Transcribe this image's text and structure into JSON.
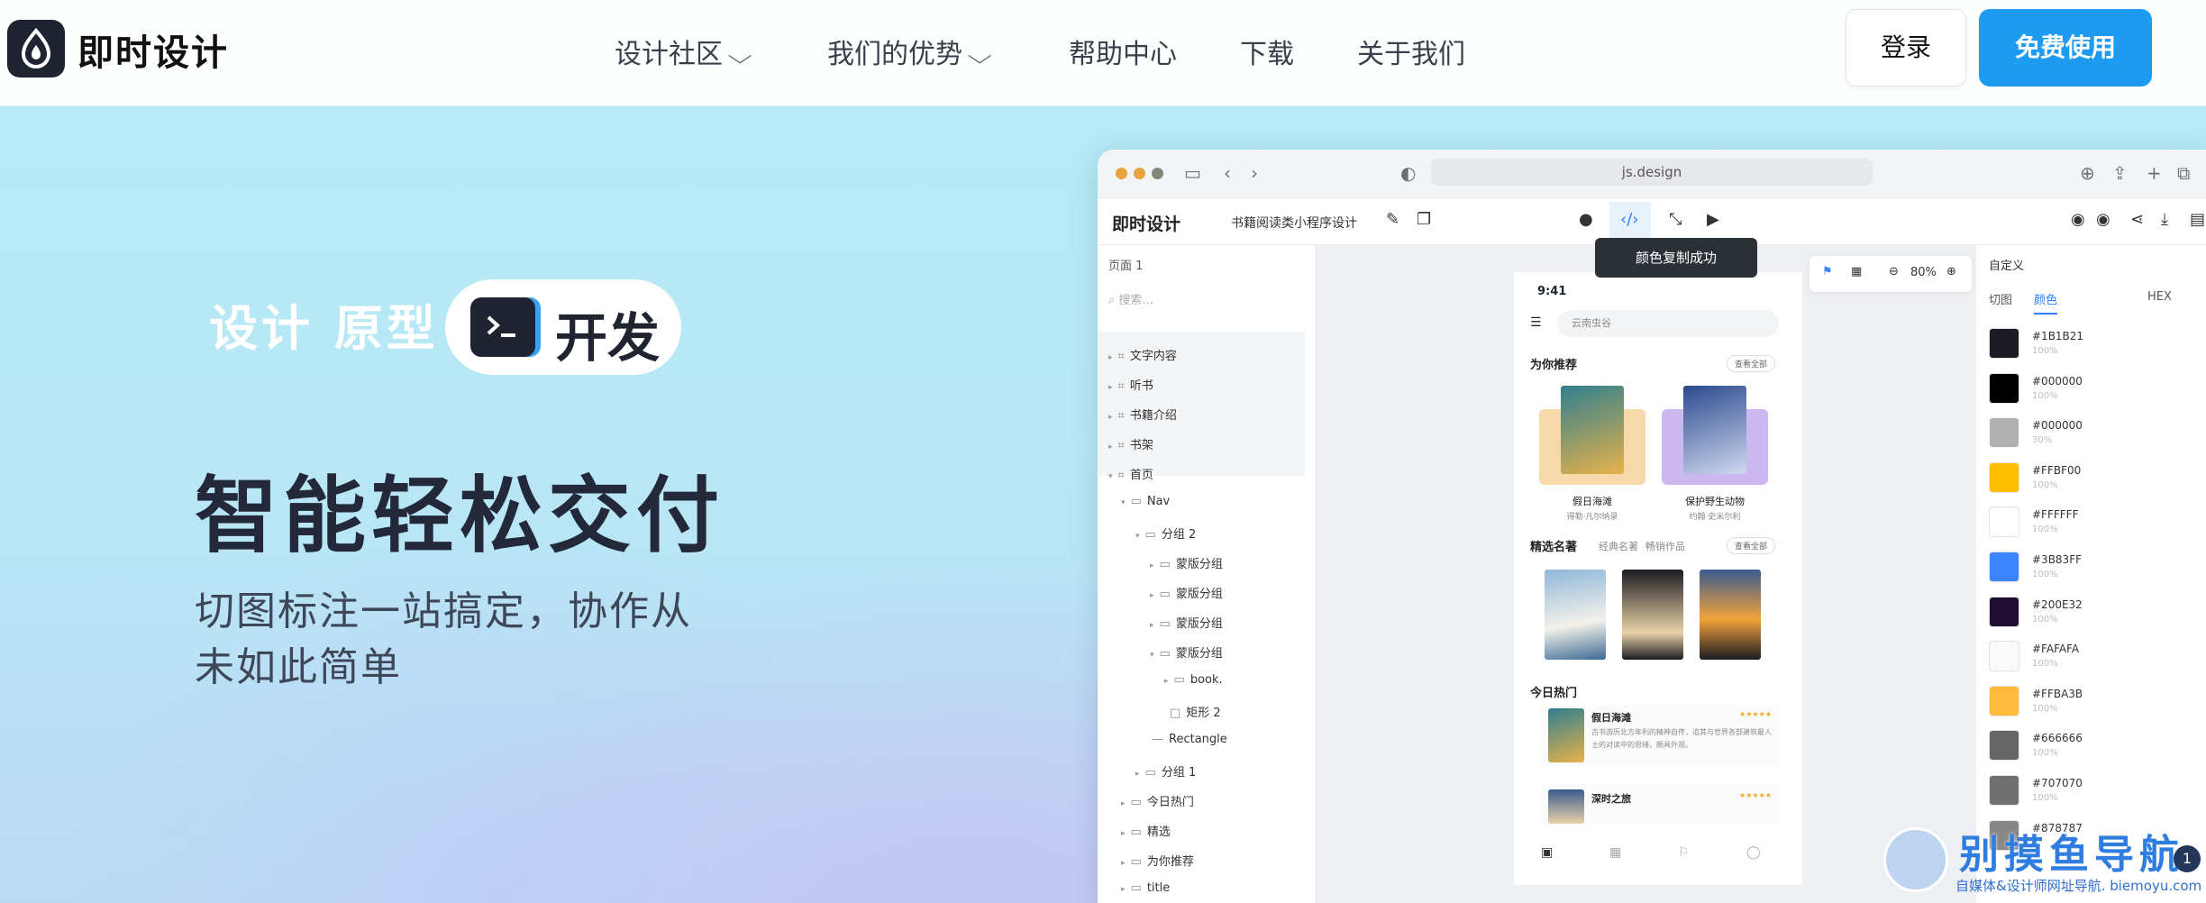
{
  "nav": {
    "brand": "即时设计",
    "items": [
      {
        "label": "设计社区",
        "chevron": true
      },
      {
        "label": "我们的优势",
        "chevron": true
      },
      {
        "label": "帮助中心"
      },
      {
        "label": "下载"
      },
      {
        "label": "关于我们"
      }
    ],
    "login": "登录",
    "cta": "免费使用"
  },
  "hero": {
    "tags": "设计 原型",
    "dev": "开发",
    "headline": "智能轻松交付",
    "sub": "切图标注一站搞定，协作从未如此简单"
  },
  "app": {
    "url": "js.design",
    "brand": "即时设计",
    "file": "书籍阅读类小程序设计",
    "tooltip": "颜色复制成功",
    "left": {
      "page": "页面 1",
      "search": "搜索...",
      "layers": [
        "文字内容",
        "听书",
        "书籍介绍",
        "书架",
        "首页",
        "Nav",
        "分组 2",
        "蒙版分组",
        "蒙版分组",
        "蒙版分组",
        "蒙版分组",
        "book.",
        "矩形 2",
        "Rectangle",
        "分组 1",
        "今日热门",
        "精选",
        "为你推荐",
        "title"
      ]
    },
    "zoom": "80%",
    "phone": {
      "time": "9:41",
      "search": "云南虫谷",
      "rec": "为你推荐",
      "rec_more": "查看全部",
      "b1": "假日海滩",
      "b1s": "得勒·凡尔纳录",
      "b2": "保护野生动物",
      "b2s": "约翰·史米尔利",
      "sel": "精选名著",
      "tab1": "经典名著",
      "tab2": "畅销作品",
      "sel_more": "查看全部",
      "hot": "今日热门",
      "h1": "假日海滩",
      "h1d": "古书游历北方年利的精神自传，追其与世界各部建筑最人士的对读中的思绪，颇具外观。",
      "h2": "深时之旅",
      "stars": "★★★★★"
    },
    "right": {
      "title": "自定义",
      "tab1": "切图",
      "tab2": "颜色",
      "tab3": "HEX",
      "colors": [
        {
          "hex": "#1B1B21",
          "op": "100%"
        },
        {
          "hex": "#000000",
          "op": "100%"
        },
        {
          "hex": "#000000",
          "op": "30%"
        },
        {
          "hex": "#FFBF00",
          "op": "100%"
        },
        {
          "hex": "#FFFFFF",
          "op": "100%"
        },
        {
          "hex": "#3B83FF",
          "op": "100%"
        },
        {
          "hex": "#200E32",
          "op": "100%"
        },
        {
          "hex": "#FAFAFA",
          "op": "100%"
        },
        {
          "hex": "#FFBA3B",
          "op": "100%"
        },
        {
          "hex": "#666666",
          "op": "100%"
        },
        {
          "hex": "#707070",
          "op": "100%"
        },
        {
          "hex": "#878787",
          "op": ""
        }
      ]
    }
  },
  "watermark": {
    "title": "别摸鱼导航",
    "sub": "自媒体&设计师网址导航. biemoyu.com",
    "badge": "1"
  }
}
